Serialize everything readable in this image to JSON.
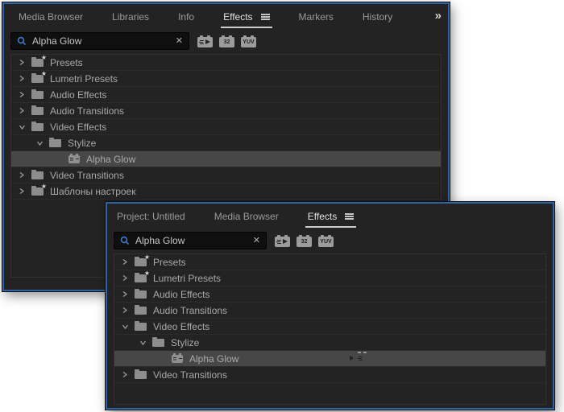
{
  "back_panel": {
    "tabs": [
      {
        "label": "Media Browser"
      },
      {
        "label": "Libraries"
      },
      {
        "label": "Info"
      },
      {
        "label": "Effects"
      },
      {
        "label": "Markers"
      },
      {
        "label": "History"
      }
    ],
    "overflow_glyph": "»",
    "search": {
      "value": "Alpha Glow",
      "clear_glyph": "✕"
    },
    "filters": {
      "bit32_label": "32",
      "yuv_label": "YUV"
    },
    "tree": [
      {
        "label": "Presets"
      },
      {
        "label": "Lumetri Presets"
      },
      {
        "label": "Audio Effects"
      },
      {
        "label": "Audio Transitions"
      },
      {
        "label": "Video Effects"
      },
      {
        "label": "Stylize"
      },
      {
        "label": "Alpha Glow"
      },
      {
        "label": "Video Transitions"
      },
      {
        "label": "Шаблоны настроек"
      }
    ]
  },
  "front_panel": {
    "tabs": [
      {
        "label": "Project: Untitled"
      },
      {
        "label": "Media Browser"
      },
      {
        "label": "Effects"
      }
    ],
    "search": {
      "value": "Alpha Glow",
      "clear_glyph": "✕"
    },
    "filters": {
      "bit32_label": "32",
      "yuv_label": "YUV"
    },
    "tree": [
      {
        "label": "Presets"
      },
      {
        "label": "Lumetri Presets"
      },
      {
        "label": "Audio Effects"
      },
      {
        "label": "Audio Transitions"
      },
      {
        "label": "Video Effects"
      },
      {
        "label": "Stylize"
      },
      {
        "label": "Alpha Glow"
      },
      {
        "label": "Video Transitions"
      }
    ]
  }
}
